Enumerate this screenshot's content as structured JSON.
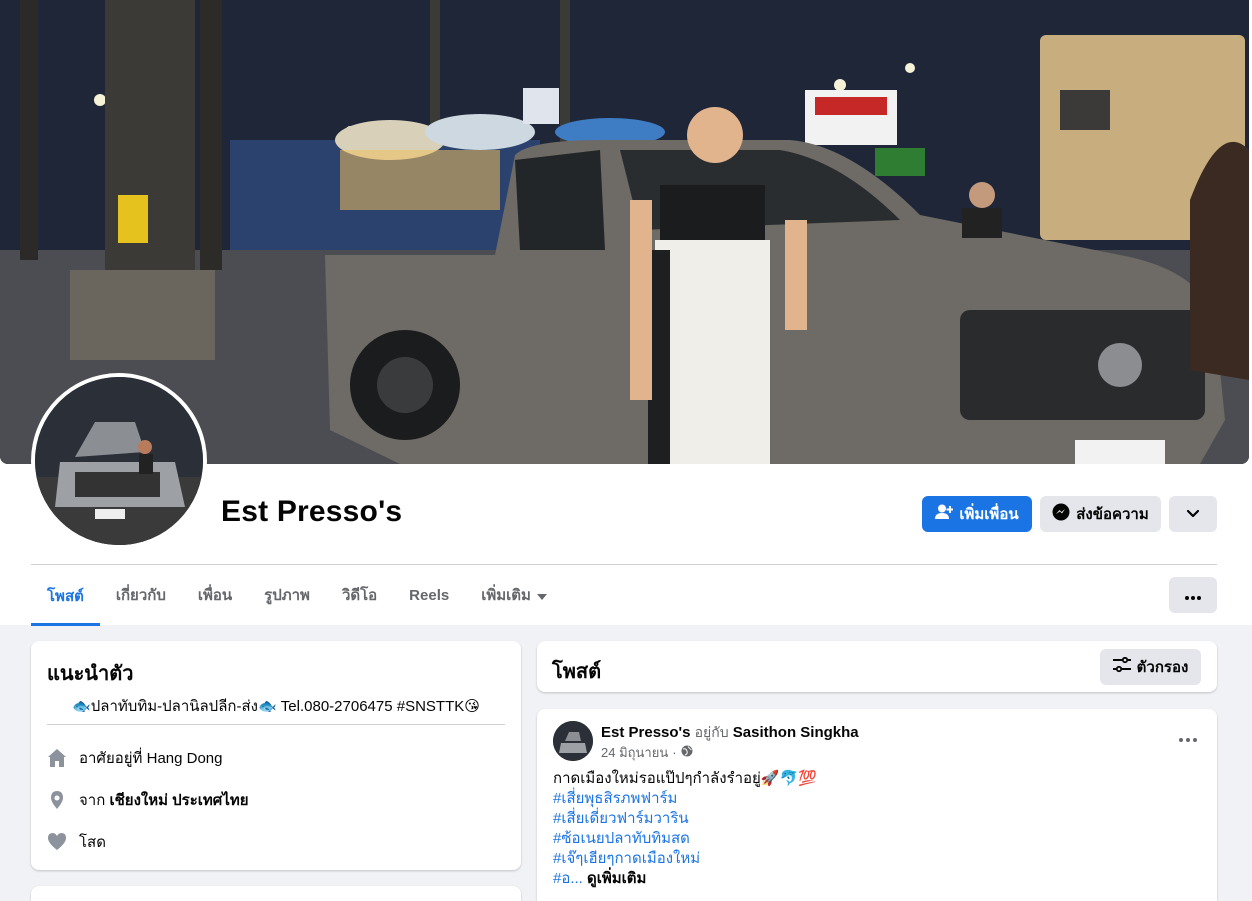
{
  "profile": {
    "name": "Est Presso's",
    "add_friend_label": "เพิ่มเพื่อน",
    "message_label": "ส่งข้อความ"
  },
  "tabs": [
    {
      "label": "โพสต์",
      "active": true
    },
    {
      "label": "เกี่ยวกับ",
      "active": false
    },
    {
      "label": "เพื่อน",
      "active": false
    },
    {
      "label": "รูปภาพ",
      "active": false
    },
    {
      "label": "วิดีโอ",
      "active": false
    },
    {
      "label": "Reels",
      "active": false
    },
    {
      "label": "เพิ่มเติม",
      "active": false
    }
  ],
  "intro": {
    "title": "แนะนำตัว",
    "bio": "🐟ปลาทับทิม-ปลานิลปลีก-ส่ง🐟 Tel.080-2706475 #SNSTTK😘",
    "lives_prefix": "อาศัยอยู่ที่",
    "lives_place": "Hang Dong",
    "from_prefix": "จาก",
    "from_place": "เชียงใหม่ ประเทศไทย",
    "relationship": "โสด"
  },
  "posts_section": {
    "title": "โพสต์",
    "filter_label": "ตัวกรอง"
  },
  "post": {
    "author": "Est Presso's",
    "with_text": "อยู่กับ",
    "tagged": "Sasithon Singkha",
    "date": "24 มิถุนายน",
    "text": "กาดเมืองใหม่รอแป๊ปๆกำลังรำอยู่🚀🐬💯",
    "hashtags": [
      "#เสี่ยพุธสิรภพฟาร์ม",
      "#เสี่ยเดี่ยวฟาร์มวาริน",
      "#ซ้อเนยปลาทับทิมสด",
      "#เจ๊ๆเฮียๆกาดเมืองใหม่"
    ],
    "truncated": "#อ...",
    "see_more": "ดูเพิ่มเติม"
  },
  "colors": {
    "accent": "#1b74e4",
    "secondary_button": "#e4e6eb",
    "page_background": "#f0f2f5",
    "muted_text": "#65676b"
  },
  "icons": [
    "add-friend-icon",
    "messenger-icon",
    "chevron-down-icon",
    "more-icon",
    "filter-icon",
    "home-icon",
    "location-icon",
    "heart-icon",
    "globe-icon",
    "caret-down-icon"
  ]
}
